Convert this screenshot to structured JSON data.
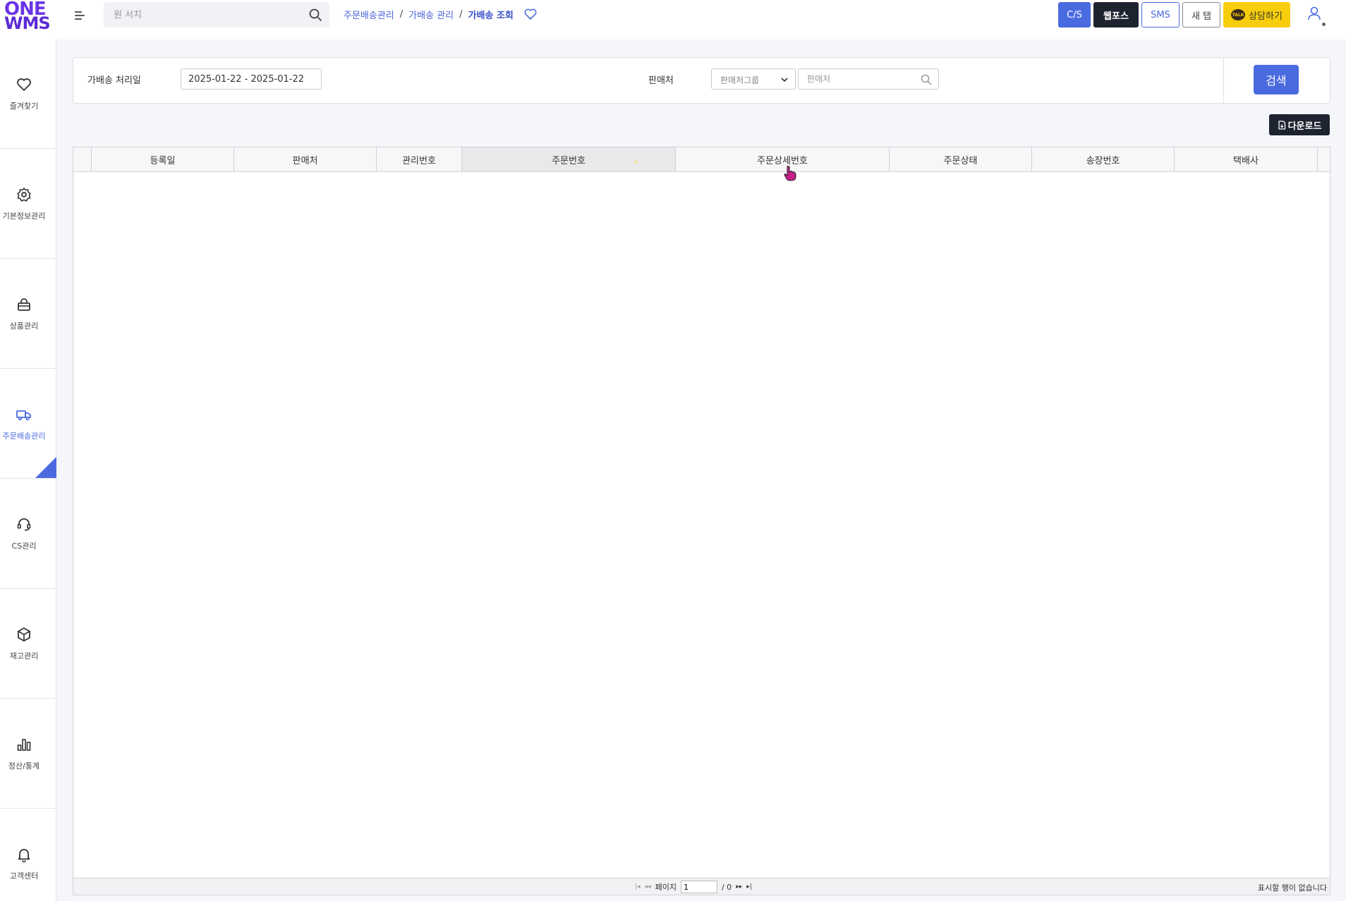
{
  "header": {
    "logo_line1": "ONE",
    "logo_line2": "WMS",
    "search_placeholder": "원 서치",
    "breadcrumb": [
      "주문배송관리",
      "가배송 관리",
      "가배송 조회"
    ],
    "breadcrumb_sep": "/",
    "buttons": {
      "cs": "C/S",
      "webpos": "웹포스",
      "sms": "SMS",
      "newtab": "새 탭",
      "consult": "상담하기",
      "consult_badge": "TALK"
    }
  },
  "sidebar": {
    "items": [
      {
        "label": "즐겨찾기",
        "icon": "heart-icon"
      },
      {
        "label": "기본정보관리",
        "icon": "gear-icon"
      },
      {
        "label": "상품관리",
        "icon": "lock-bag-icon"
      },
      {
        "label": "주문배송관리",
        "icon": "truck-icon",
        "active": true
      },
      {
        "label": "CS관리",
        "icon": "headset-icon"
      },
      {
        "label": "재고관리",
        "icon": "box-icon"
      },
      {
        "label": "정산/통계",
        "icon": "bar-chart-icon"
      },
      {
        "label": "고객센터",
        "icon": "bell-icon"
      }
    ]
  },
  "filter": {
    "date_label": "가배송 처리일",
    "date_value": "2025-01-22 - 2025-01-22",
    "shop_label": "판매처",
    "shop_group_placeholder": "판매처그룹",
    "shop_placeholder": "판매처",
    "search_button": "검색"
  },
  "download_button": "다운로드",
  "grid": {
    "columns": [
      "등록일",
      "판매처",
      "관리번호",
      "주문번호",
      "주문상세번호",
      "주문상태",
      "송장번호",
      "택배사"
    ],
    "rows": [],
    "footer": {
      "page_label": "페이지",
      "page_value": "1",
      "page_total": "/ 0",
      "empty_message": "표시할 행이 없습니다"
    }
  },
  "colors": {
    "accent": "#4a6be0",
    "dark": "#1e2330",
    "kakao_yellow": "#f7cd0c",
    "logo_purple": "#6a35e8"
  }
}
